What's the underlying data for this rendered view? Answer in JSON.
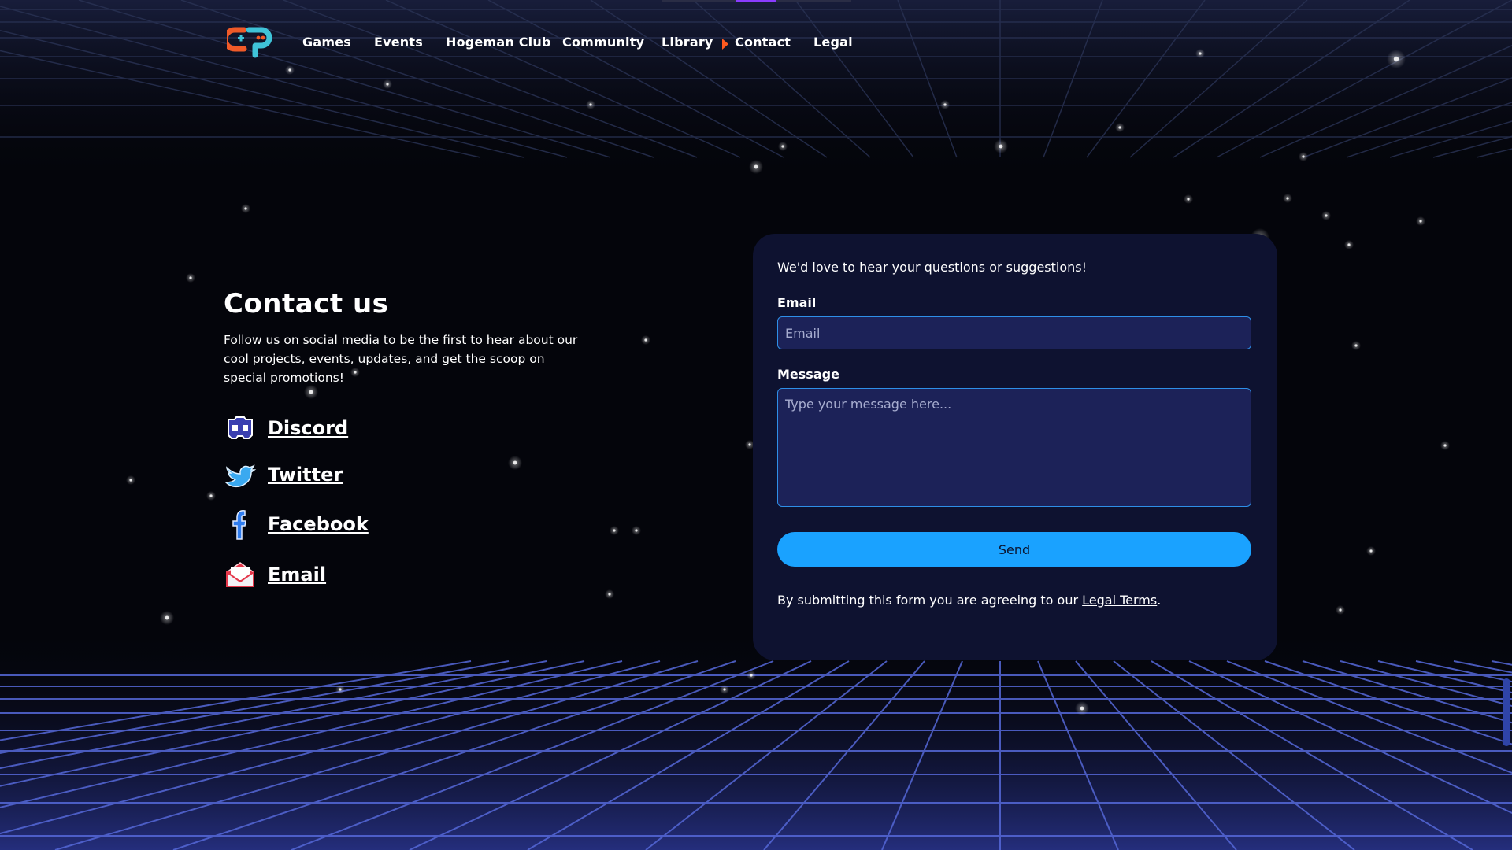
{
  "nav": {
    "logo_alt": "logo",
    "items": [
      {
        "label": "Games"
      },
      {
        "label": "Events"
      },
      {
        "label": "Hogeman Club"
      },
      {
        "label": "Community"
      },
      {
        "label": "Library"
      },
      {
        "label": "Contact",
        "active": true
      },
      {
        "label": "Legal"
      }
    ]
  },
  "contact": {
    "title": "Contact us",
    "intro": "Follow us on social media to be the first to hear about our cool projects, events, updates, and get the scoop on special promotions!",
    "socials": [
      {
        "label": "Discord",
        "icon": "discord-icon"
      },
      {
        "label": "Twitter",
        "icon": "twitter-icon"
      },
      {
        "label": "Facebook",
        "icon": "facebook-icon"
      },
      {
        "label": "Email",
        "icon": "envelope-icon"
      }
    ]
  },
  "form": {
    "lead": "We'd love to hear your questions or suggestions!",
    "email_label": "Email",
    "email_placeholder": "Email",
    "message_label": "Message",
    "message_placeholder": "Type your message here...",
    "send_label": "Send",
    "legal_prefix": "By submitting this form you are agreeing to our ",
    "legal_link": "Legal Terms",
    "legal_suffix": "."
  },
  "colors": {
    "background": "#04050b",
    "card": "#0e1230",
    "input_bg": "#1c2258",
    "input_border": "#2e8fe8",
    "button": "#1aa2ff",
    "grid": "#3b4aa8",
    "active_marker": "#ff5a1f",
    "logo_orange": "#f05a28",
    "logo_teal": "#3fc3d8"
  }
}
